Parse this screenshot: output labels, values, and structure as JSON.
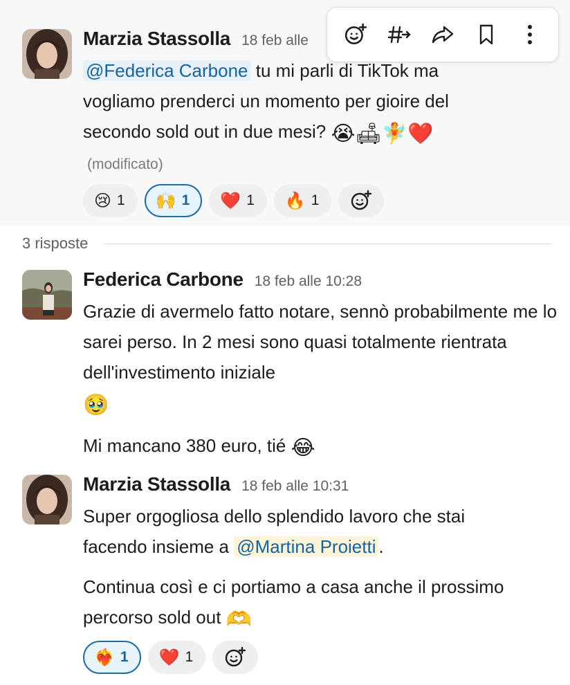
{
  "toolbar": {
    "icons": [
      "add-reaction-icon",
      "forward-to-channel-icon",
      "share-icon",
      "bookmark-icon",
      "more-icon"
    ]
  },
  "messages": [
    {
      "author": "Marzia Stassolla",
      "time": "18 feb alle",
      "mention": "@Federica Carbone",
      "text_after_mention": " tu mi parli di TikTok ma vogliamo prenderci un momento per gioire del secondo sold out in due mesi? ",
      "trailing_emoji": "😭🛋🧚❤️",
      "edited": "(modificato)",
      "reactions": [
        {
          "emoji": "😢",
          "count": "1",
          "active": false
        },
        {
          "emoji": "🙌",
          "count": "1",
          "active": true
        },
        {
          "emoji": "❤️",
          "count": "1",
          "active": false
        },
        {
          "emoji": "🔥",
          "count": "1",
          "active": false
        }
      ]
    },
    {
      "author": "Federica Carbone",
      "time": "18 feb alle 10:28",
      "para1": "Grazie di avermelo fatto notare, sennò probabilmente me lo sarei perso. In 2 mesi sono quasi totalmente rientrata dell'investimento iniziale",
      "para1_emoji": "🥹",
      "para2": "Mi mancano 380 euro, tié ",
      "para2_emoji": "😂"
    },
    {
      "author": "Marzia Stassolla",
      "time": "18 feb alle 10:31",
      "text_before_mention": "Super orgogliosa dello splendido lavoro che stai facendo insieme a ",
      "mention": "@Martina Proietti",
      "text_after_mention": ".",
      "para2": "Continua così e ci portiamo a casa anche il prossimo percorso sold out ",
      "para2_emoji": "🫶",
      "reactions": [
        {
          "emoji": "❤️‍🔥",
          "count": "1",
          "active": true
        },
        {
          "emoji": "❤️",
          "count": "1",
          "active": false
        }
      ]
    }
  ],
  "thread": {
    "replies_label": "3 risposte"
  },
  "colors": {
    "mention_text": "#1264a3",
    "mention_bg": "#e8f1f8",
    "active_reaction_border": "#1d6ba7",
    "highlight_bg": "#f8f8f8"
  }
}
